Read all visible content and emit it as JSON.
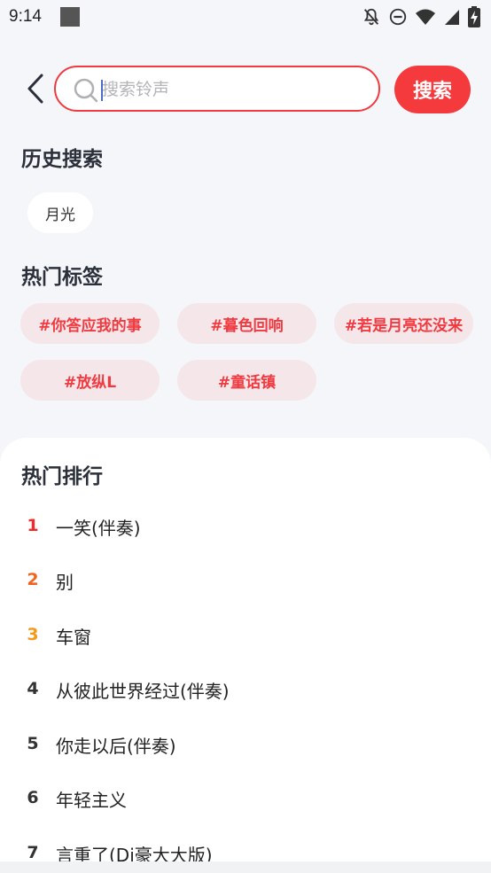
{
  "status_bar": {
    "time": "9:14"
  },
  "search": {
    "placeholder": "搜索铃声",
    "value": "",
    "button_label": "搜索"
  },
  "history": {
    "title": "历史搜索",
    "items": [
      "月光"
    ]
  },
  "hot_tags": {
    "title": "热门标签",
    "tags": [
      "#你答应我的事",
      "#暮色回响",
      "#若是月亮还没来",
      "#放纵L",
      "#童话镇"
    ]
  },
  "ranking": {
    "title": "热门排行",
    "items": [
      {
        "rank": "1",
        "name": "一笑(伴奏)"
      },
      {
        "rank": "2",
        "name": "别"
      },
      {
        "rank": "3",
        "name": "车窗"
      },
      {
        "rank": "4",
        "name": "从彼此世界经过(伴奏)"
      },
      {
        "rank": "5",
        "name": "你走以后(伴奏)"
      },
      {
        "rank": "6",
        "name": "年轻主义"
      },
      {
        "rank": "7",
        "name": "言重了(Dj豪大大版)"
      }
    ]
  },
  "colors": {
    "accent": "#f53a3d",
    "tag_background": "#f5e6e9",
    "page_background": "#f5f6fa",
    "rank1": "#ee2c2c",
    "rank2": "#f06420",
    "rank3": "#f39a1b"
  },
  "icons": {
    "status": [
      "notifications-off-icon",
      "do-not-disturb-icon",
      "wifi-icon",
      "signal-icon",
      "battery-charging-icon"
    ],
    "back": "back-arrow-icon",
    "search": "search-icon"
  }
}
